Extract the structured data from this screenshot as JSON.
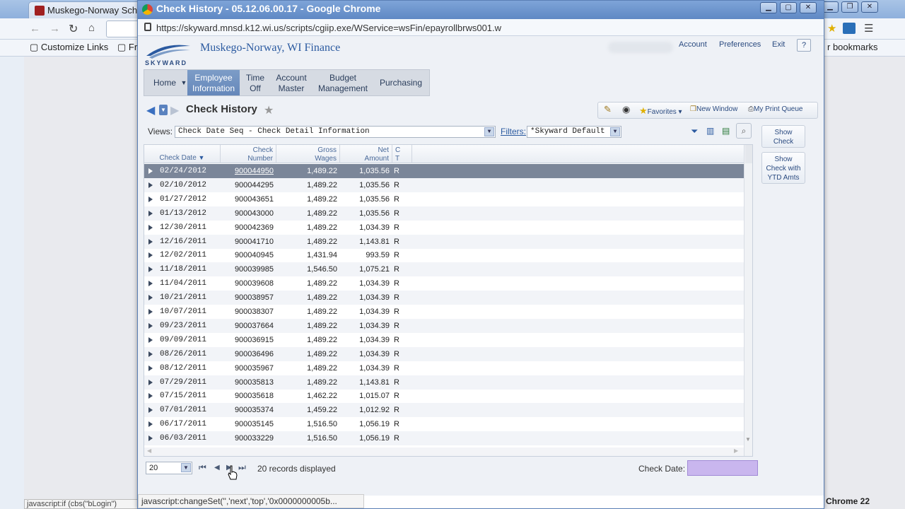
{
  "background_browser": {
    "tab_title": "Muskego-Norway Sch",
    "bookmarks": [
      "Customize Links",
      "Fr"
    ],
    "bookmarks_right": "r bookmarks",
    "status_text": "javascript:if (cbs(\"bLogin\")",
    "taskbar_label": "Chrome 22"
  },
  "window": {
    "title": "Check History - 05.12.06.00.17 - Google Chrome",
    "url": "https://skyward.mnsd.k12.wi.us/scripts/cgiip.exe/WService=wsFin/epayrollbrws001.w"
  },
  "header": {
    "logo_text": "SKYWARD",
    "org_name": "Muskego-Norway, WI Finance",
    "links": [
      "Account",
      "Preferences",
      "Exit"
    ],
    "help_label": "?"
  },
  "menu": [
    {
      "label1": "Home",
      "label2": ""
    },
    {
      "label1": "Employee",
      "label2": "Information"
    },
    {
      "label1": "Time",
      "label2": "Off"
    },
    {
      "label1": "Account",
      "label2": "Master"
    },
    {
      "label1": "Budget",
      "label2": "Management"
    },
    {
      "label1": "Purchasing",
      "label2": ""
    }
  ],
  "page": {
    "title": "Check History",
    "toolbar": {
      "favorites": "Favorites",
      "new_window": "New Window",
      "print_queue": "My Print Queue"
    },
    "views_label": "Views:",
    "views_value": "Check Date Seq - Check Detail Information",
    "filters_label": "Filters:",
    "filters_value": "*Skyward Default"
  },
  "grid": {
    "headers": [
      {
        "line1": "Check Date",
        "line2": ""
      },
      {
        "line1": "Check",
        "line2": "Number"
      },
      {
        "line1": "Gross",
        "line2": "Wages"
      },
      {
        "line1": "Net",
        "line2": "Amount"
      },
      {
        "line1": "C",
        "line2": "T"
      }
    ],
    "rows": [
      [
        "02/24/2012",
        "900044950",
        "1,489.22",
        "1,035.56",
        "R"
      ],
      [
        "02/10/2012",
        "900044295",
        "1,489.22",
        "1,035.56",
        "R"
      ],
      [
        "01/27/2012",
        "900043651",
        "1,489.22",
        "1,035.56",
        "R"
      ],
      [
        "01/13/2012",
        "900043000",
        "1,489.22",
        "1,035.56",
        "R"
      ],
      [
        "12/30/2011",
        "900042369",
        "1,489.22",
        "1,034.39",
        "R"
      ],
      [
        "12/16/2011",
        "900041710",
        "1,489.22",
        "1,143.81",
        "R"
      ],
      [
        "12/02/2011",
        "900040945",
        "1,431.94",
        "993.59",
        "R"
      ],
      [
        "11/18/2011",
        "900039985",
        "1,546.50",
        "1,075.21",
        "R"
      ],
      [
        "11/04/2011",
        "900039608",
        "1,489.22",
        "1,034.39",
        "R"
      ],
      [
        "10/21/2011",
        "900038957",
        "1,489.22",
        "1,034.39",
        "R"
      ],
      [
        "10/07/2011",
        "900038307",
        "1,489.22",
        "1,034.39",
        "R"
      ],
      [
        "09/23/2011",
        "900037664",
        "1,489.22",
        "1,034.39",
        "R"
      ],
      [
        "09/09/2011",
        "900036915",
        "1,489.22",
        "1,034.39",
        "R"
      ],
      [
        "08/26/2011",
        "900036496",
        "1,489.22",
        "1,034.39",
        "R"
      ],
      [
        "08/12/2011",
        "900035967",
        "1,489.22",
        "1,034.39",
        "R"
      ],
      [
        "07/29/2011",
        "900035813",
        "1,489.22",
        "1,143.81",
        "R"
      ],
      [
        "07/15/2011",
        "900035618",
        "1,462.22",
        "1,015.07",
        "R"
      ],
      [
        "07/01/2011",
        "900035374",
        "1,459.22",
        "1,012.92",
        "R"
      ],
      [
        "06/17/2011",
        "900035145",
        "1,516.50",
        "1,056.19",
        "R"
      ],
      [
        "06/03/2011",
        "900033229",
        "1,516.50",
        "1,056.19",
        "R"
      ]
    ]
  },
  "side_buttons": [
    {
      "line1": "Show",
      "line2": "Check",
      "line3": ""
    },
    {
      "line1": "Show",
      "line2": "Check with",
      "line3": "YTD Amts"
    }
  ],
  "pager": {
    "page_size": "20",
    "records_text": "20 records displayed",
    "check_date_label": "Check Date:"
  },
  "status_bar": "javascript:changeSet('','next','top','0x0000000005b..."
}
